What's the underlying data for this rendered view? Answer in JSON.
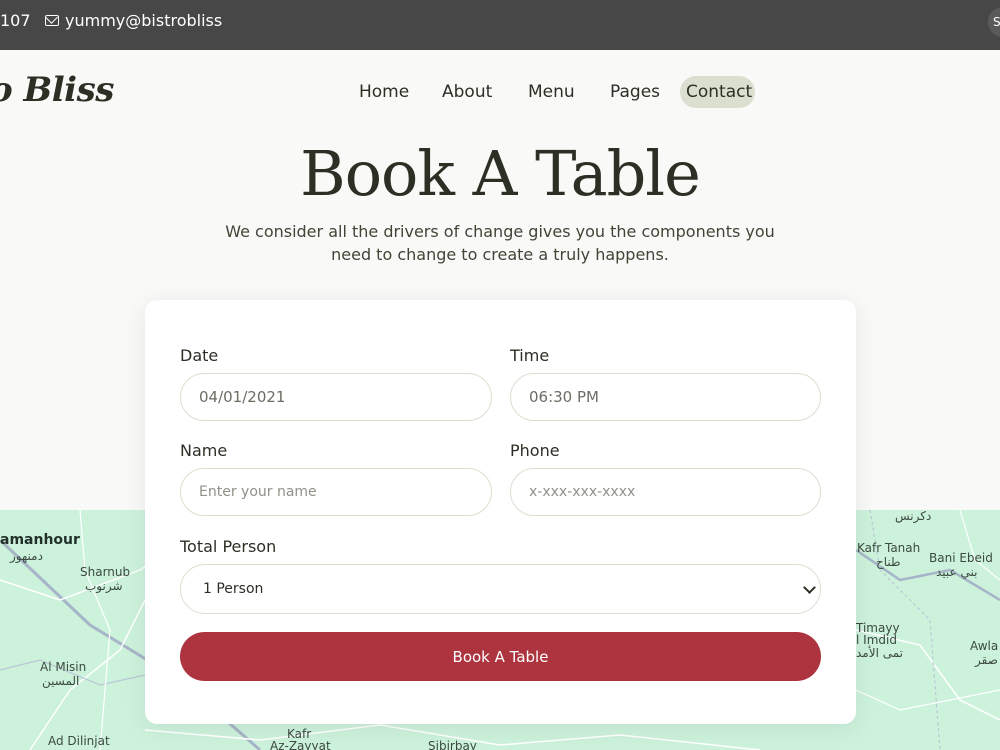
{
  "topbar": {
    "phone_fragment": "107",
    "email": "yummy@bistrobliss",
    "social_glyph": "S"
  },
  "header": {
    "logo_text": "o Bliss",
    "nav": [
      {
        "label": "Home",
        "active": false
      },
      {
        "label": "About",
        "active": false
      },
      {
        "label": "Menu",
        "active": false
      },
      {
        "label": "Pages",
        "active": false
      },
      {
        "label": "Contact",
        "active": true
      }
    ]
  },
  "hero": {
    "title": "Book A Table",
    "subtitle": "We consider all the drivers of change gives you the components you need to change to create a truly happens."
  },
  "form": {
    "date": {
      "label": "Date",
      "value": "04/01/2021"
    },
    "time": {
      "label": "Time",
      "value": "06:30 PM"
    },
    "name": {
      "label": "Name",
      "placeholder": "Enter your name"
    },
    "phone": {
      "label": "Phone",
      "placeholder": "x-xxx-xxx-xxxx"
    },
    "total_person": {
      "label": "Total Person",
      "value": "1 Person"
    },
    "submit_label": "Book A Table"
  },
  "map": {
    "labels": [
      {
        "id": "damanhour",
        "text": "amanhour"
      },
      {
        "id": "damanhour-ar",
        "text": "دمنهور"
      },
      {
        "id": "sharnub",
        "text": "Sharnub"
      },
      {
        "id": "sharnub-ar",
        "text": "شرنوب"
      },
      {
        "id": "al-misin",
        "text": "Al Misin"
      },
      {
        "id": "al-misin-ar",
        "text": "المسين"
      },
      {
        "id": "ad-dilinjat",
        "text": "Ad Dilinjat"
      },
      {
        "id": "kafr-az-zayyat",
        "text": "Kafr"
      },
      {
        "id": "kafr-az-zayyat-2",
        "text": "Az-Zayyat"
      },
      {
        "id": "sibirbay",
        "text": "Sibirbay"
      },
      {
        "id": "dikirnis-ar",
        "text": "دكرنس"
      },
      {
        "id": "kafr-tanah",
        "text": "Kafr Tanah"
      },
      {
        "id": "kafr-tanah-ar",
        "text": "طناح"
      },
      {
        "id": "bani-ebeid",
        "text": "Bani Ebeid"
      },
      {
        "id": "bani-ebeid-ar",
        "text": "بني عبيد"
      },
      {
        "id": "timayy",
        "text": "Timayy"
      },
      {
        "id": "el-imdid",
        "text": "l Imdid"
      },
      {
        "id": "timayy-ar",
        "text": "تمى الأمد"
      },
      {
        "id": "awlad",
        "text": "Awla"
      },
      {
        "id": "awlad-ar",
        "text": "صقر"
      }
    ]
  },
  "colors": {
    "accent": "#ad343e",
    "nav_active_bg": "#dbdfd0",
    "topbar_bg": "#474747",
    "map_bg": "#cdf2dc"
  }
}
